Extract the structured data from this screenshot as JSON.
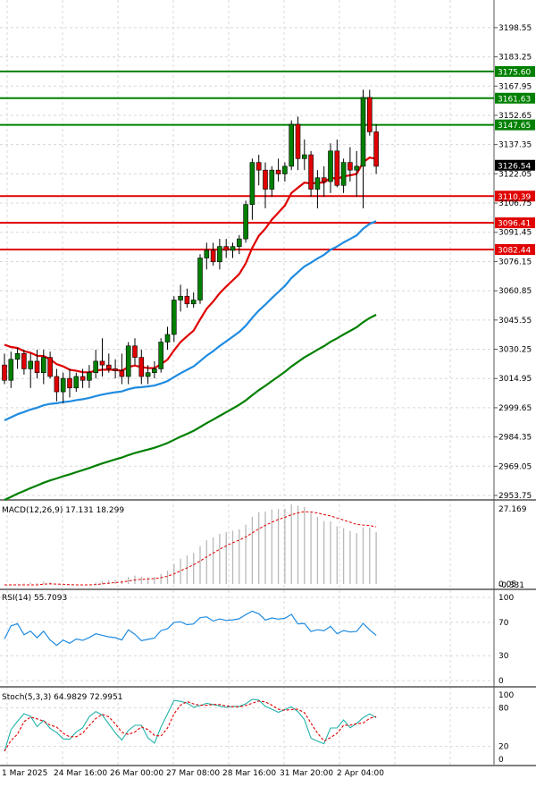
{
  "chart_data": {
    "type": "candlestick",
    "x_tick_labels": [
      "1 Mar 2025",
      "24 Mar 16:00",
      "26 Mar 00:00",
      "27 Mar 08:00",
      "28 Mar 16:00",
      "31 Mar 20:00",
      "2 Apr 04:00"
    ],
    "main_panel": {
      "y_tick_labels": [
        3198.55,
        3183.25,
        3167.95,
        3152.65,
        3137.35,
        3122.05,
        3106.75,
        3091.45,
        3076.15,
        3060.85,
        3045.55,
        3030.25,
        3014.95,
        2999.65,
        2984.35,
        2969.05,
        2953.75
      ],
      "ylim": [
        2953.75,
        3213.0
      ],
      "horizontal_levels": [
        {
          "value": 3175.6,
          "label": "3175.60",
          "color": "#008000"
        },
        {
          "value": 3161.63,
          "label": "3161.63",
          "color": "#008000"
        },
        {
          "value": 3147.65,
          "label": "3147.65",
          "color": "#008000"
        },
        {
          "value": 3110.39,
          "label": "3110.39",
          "color": "#e00000"
        },
        {
          "value": 3096.41,
          "label": "3096.41",
          "color": "#e00000"
        },
        {
          "value": 3082.44,
          "label": "3082.44",
          "color": "#e00000"
        }
      ],
      "last_price_label": "3126.54",
      "up_color": "#008000",
      "down_color": "#e00000",
      "candles": [
        [
          3022,
          3028,
          3012,
          3014
        ],
        [
          3014,
          3029,
          3010,
          3025
        ],
        [
          3025,
          3031,
          3020,
          3028
        ],
        [
          3028,
          3030,
          3017,
          3020
        ],
        [
          3020,
          3028,
          3010,
          3024
        ],
        [
          3024,
          3030,
          3015,
          3018
        ],
        [
          3018,
          3030,
          3012,
          3026
        ],
        [
          3026,
          3029,
          3015,
          3016
        ],
        [
          3016,
          3020,
          3003,
          3008
        ],
        [
          3008,
          3018,
          3002,
          3015
        ],
        [
          3015,
          3020,
          3005,
          3010
        ],
        [
          3010,
          3018,
          3008,
          3016
        ],
        [
          3016,
          3020,
          3010,
          3014
        ],
        [
          3014,
          3022,
          3010,
          3018
        ],
        [
          3018,
          3030,
          3015,
          3024
        ],
        [
          3024,
          3036,
          3016,
          3022
        ],
        [
          3022,
          3028,
          3018,
          3020
        ],
        [
          3020,
          3025,
          3015,
          3019
        ],
        [
          3019,
          3028,
          3012,
          3016
        ],
        [
          3016,
          3034,
          3012,
          3032
        ],
        [
          3032,
          3036,
          3022,
          3026
        ],
        [
          3026,
          3030,
          3012,
          3016
        ],
        [
          3016,
          3022,
          3012,
          3018
        ],
        [
          3018,
          3024,
          3015,
          3020
        ],
        [
          3020,
          3036,
          3018,
          3034
        ],
        [
          3034,
          3042,
          3030,
          3038
        ],
        [
          3038,
          3058,
          3034,
          3056
        ],
        [
          3056,
          3064,
          3050,
          3058
        ],
        [
          3058,
          3062,
          3052,
          3054
        ],
        [
          3054,
          3060,
          3052,
          3056
        ],
        [
          3056,
          3080,
          3054,
          3078
        ],
        [
          3078,
          3086,
          3072,
          3082
        ],
        [
          3082,
          3086,
          3074,
          3076
        ],
        [
          3076,
          3088,
          3072,
          3084
        ],
        [
          3084,
          3088,
          3078,
          3082
        ],
        [
          3082,
          3086,
          3078,
          3084
        ],
        [
          3084,
          3090,
          3080,
          3088
        ],
        [
          3088,
          3108,
          3086,
          3106
        ],
        [
          3106,
          3130,
          3098,
          3128
        ],
        [
          3128,
          3132,
          3116,
          3124
        ],
        [
          3124,
          3128,
          3104,
          3114
        ],
        [
          3114,
          3126,
          3110,
          3124
        ],
        [
          3124,
          3130,
          3118,
          3122
        ],
        [
          3122,
          3128,
          3118,
          3126
        ],
        [
          3126,
          3150,
          3124,
          3148
        ],
        [
          3148,
          3152,
          3124,
          3130
        ],
        [
          3130,
          3140,
          3124,
          3132
        ],
        [
          3132,
          3134,
          3110,
          3114
        ],
        [
          3114,
          3124,
          3104,
          3120
        ],
        [
          3120,
          3126,
          3110,
          3118
        ],
        [
          3118,
          3138,
          3112,
          3134
        ],
        [
          3134,
          3140,
          3115,
          3116
        ],
        [
          3116,
          3130,
          3112,
          3128
        ],
        [
          3128,
          3136,
          3118,
          3124
        ],
        [
          3124,
          3134,
          3110,
          3126
        ],
        [
          3126,
          3166,
          3104,
          3162
        ],
        [
          3162,
          3166,
          3142,
          3144
        ],
        [
          3144,
          3148,
          3122,
          3126
        ]
      ],
      "ma_fast_color": "#e00000",
      "ma_mid_color": "#1f8be0",
      "ma_slow_color": "#008000"
    },
    "macd_panel": {
      "label": "MACD(12,26,9) 17.131 18.299",
      "y_tick_labels": [
        "27.169",
        "0.05",
        "-0.331"
      ],
      "ylim": [
        -0.331,
        27.169
      ]
    },
    "rsi_panel": {
      "label": "RSI(14) 55.7093",
      "y_tick_labels": [
        100,
        70,
        30,
        0
      ],
      "ylim": [
        0,
        100
      ]
    },
    "stoch_panel": {
      "label": "Stoch(5,3,3) 64.9829 72.9951",
      "y_tick_labels": [
        100,
        80,
        20,
        0
      ],
      "ylim": [
        0,
        100
      ]
    }
  }
}
